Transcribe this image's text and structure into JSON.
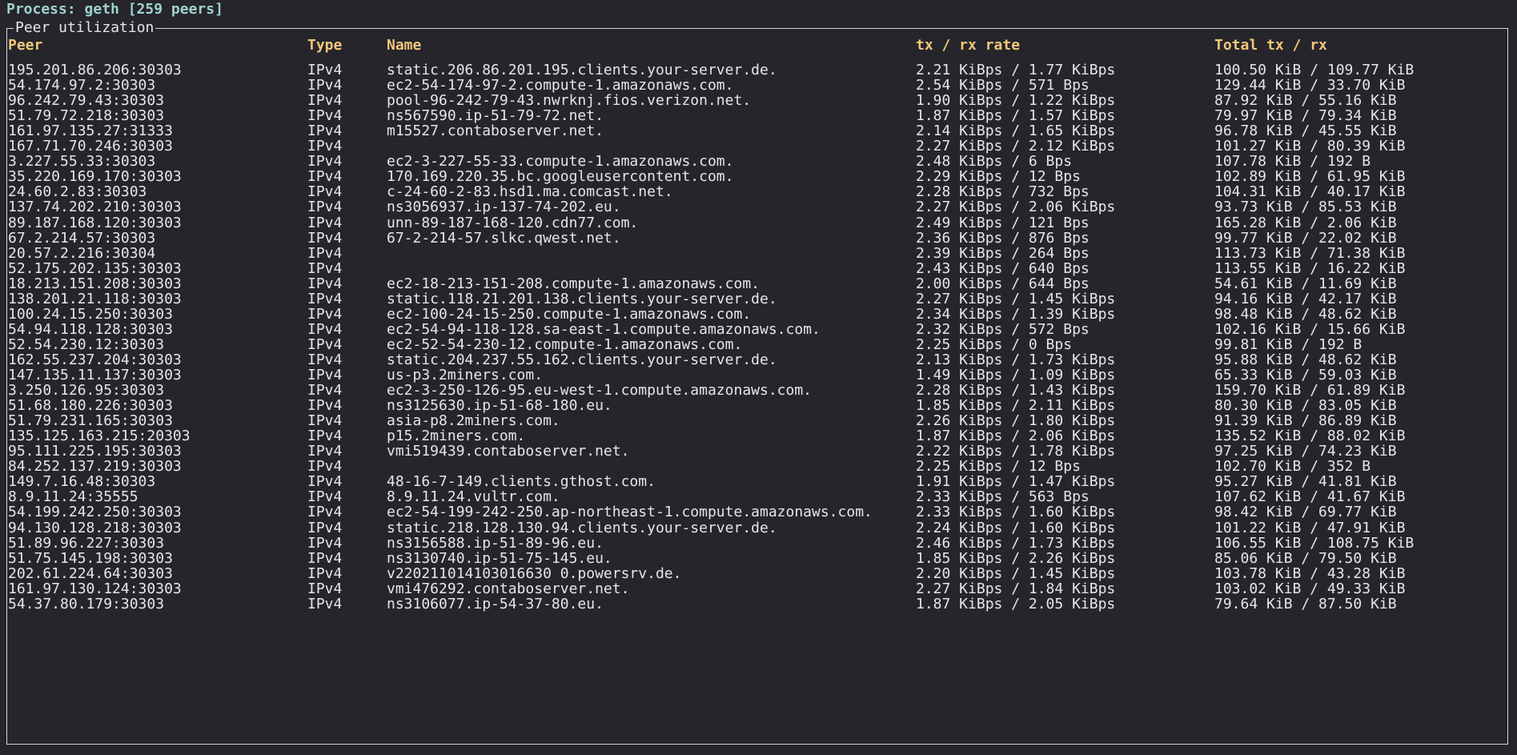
{
  "process": {
    "title": "Process: geth [259 peers]"
  },
  "panel": {
    "title": "Peer utilization"
  },
  "table": {
    "columns": [
      "Peer",
      "Type",
      "Name",
      "tx / rx rate",
      "Total tx / rx"
    ],
    "rows": [
      [
        "195.201.86.206:30303",
        "IPv4",
        "static.206.86.201.195.clients.your-server.de.",
        "2.21 KiBps / 1.77 KiBps",
        "100.50 KiB / 109.77 KiB"
      ],
      [
        "54.174.97.2:30303",
        "IPv4",
        "ec2-54-174-97-2.compute-1.amazonaws.com.",
        "2.54 KiBps / 571 Bps",
        "129.44 KiB / 33.70 KiB"
      ],
      [
        "96.242.79.43:30303",
        "IPv4",
        "pool-96-242-79-43.nwrknj.fios.verizon.net.",
        "1.90 KiBps / 1.22 KiBps",
        "87.92 KiB / 55.16 KiB"
      ],
      [
        "51.79.72.218:30303",
        "IPv4",
        "ns567590.ip-51-79-72.net.",
        "1.87 KiBps / 1.57 KiBps",
        "79.97 KiB / 79.34 KiB"
      ],
      [
        "161.97.135.27:31333",
        "IPv4",
        "m15527.contaboserver.net.",
        "2.14 KiBps / 1.65 KiBps",
        "96.78 KiB / 45.55 KiB"
      ],
      [
        "167.71.70.246:30303",
        "IPv4",
        "",
        "2.27 KiBps / 2.12 KiBps",
        "101.27 KiB / 80.39 KiB"
      ],
      [
        "3.227.55.33:30303",
        "IPv4",
        "ec2-3-227-55-33.compute-1.amazonaws.com.",
        "2.48 KiBps / 6 Bps",
        "107.78 KiB / 192 B"
      ],
      [
        "35.220.169.170:30303",
        "IPv4",
        "170.169.220.35.bc.googleusercontent.com.",
        "2.29 KiBps / 12 Bps",
        "102.89 KiB / 61.95 KiB"
      ],
      [
        "24.60.2.83:30303",
        "IPv4",
        "c-24-60-2-83.hsd1.ma.comcast.net.",
        "2.28 KiBps / 732 Bps",
        "104.31 KiB / 40.17 KiB"
      ],
      [
        "137.74.202.210:30303",
        "IPv4",
        "ns3056937.ip-137-74-202.eu.",
        "2.27 KiBps / 2.06 KiBps",
        "93.73 KiB / 85.53 KiB"
      ],
      [
        "89.187.168.120:30303",
        "IPv4",
        "unn-89-187-168-120.cdn77.com.",
        "2.49 KiBps / 121 Bps",
        "165.28 KiB / 2.06 KiB"
      ],
      [
        "67.2.214.57:30303",
        "IPv4",
        "67-2-214-57.slkc.qwest.net.",
        "2.36 KiBps / 876 Bps",
        "99.77 KiB / 22.02 KiB"
      ],
      [
        "20.57.2.216:30304",
        "IPv4",
        "",
        "2.39 KiBps / 264 Bps",
        "113.73 KiB / 71.38 KiB"
      ],
      [
        "52.175.202.135:30303",
        "IPv4",
        "",
        "2.43 KiBps / 640 Bps",
        "113.55 KiB / 16.22 KiB"
      ],
      [
        "18.213.151.208:30303",
        "IPv4",
        "ec2-18-213-151-208.compute-1.amazonaws.com.",
        "2.00 KiBps / 644 Bps",
        "54.61 KiB / 11.69 KiB"
      ],
      [
        "138.201.21.118:30303",
        "IPv4",
        "static.118.21.201.138.clients.your-server.de.",
        "2.27 KiBps / 1.45 KiBps",
        "94.16 KiB / 42.17 KiB"
      ],
      [
        "100.24.15.250:30303",
        "IPv4",
        "ec2-100-24-15-250.compute-1.amazonaws.com.",
        "2.34 KiBps / 1.39 KiBps",
        "98.48 KiB / 48.62 KiB"
      ],
      [
        "54.94.118.128:30303",
        "IPv4",
        "ec2-54-94-118-128.sa-east-1.compute.amazonaws.com.",
        "2.32 KiBps / 572 Bps",
        "102.16 KiB / 15.66 KiB"
      ],
      [
        "52.54.230.12:30303",
        "IPv4",
        "ec2-52-54-230-12.compute-1.amazonaws.com.",
        "2.25 KiBps / 0 Bps",
        "99.81 KiB / 192 B"
      ],
      [
        "162.55.237.204:30303",
        "IPv4",
        "static.204.237.55.162.clients.your-server.de.",
        "2.13 KiBps / 1.73 KiBps",
        "95.88 KiB / 48.62 KiB"
      ],
      [
        "147.135.11.137:30303",
        "IPv4",
        "us-p3.2miners.com.",
        "1.49 KiBps / 1.09 KiBps",
        "65.33 KiB / 59.03 KiB"
      ],
      [
        "3.250.126.95:30303",
        "IPv4",
        "ec2-3-250-126-95.eu-west-1.compute.amazonaws.com.",
        "2.28 KiBps / 1.43 KiBps",
        "159.70 KiB / 61.89 KiB"
      ],
      [
        "51.68.180.226:30303",
        "IPv4",
        "ns3125630.ip-51-68-180.eu.",
        "1.85 KiBps / 2.11 KiBps",
        "80.30 KiB / 83.05 KiB"
      ],
      [
        "51.79.231.165:30303",
        "IPv4",
        "asia-p8.2miners.com.",
        "2.26 KiBps / 1.80 KiBps",
        "91.39 KiB / 86.89 KiB"
      ],
      [
        "135.125.163.215:20303",
        "IPv4",
        "p15.2miners.com.",
        "1.87 KiBps / 2.06 KiBps",
        "135.52 KiB / 88.02 KiB"
      ],
      [
        "95.111.225.195:30303",
        "IPv4",
        "vmi519439.contaboserver.net.",
        "2.22 KiBps / 1.78 KiBps",
        "97.25 KiB / 74.23 KiB"
      ],
      [
        "84.252.137.219:30303",
        "IPv4",
        "",
        "2.25 KiBps / 12 Bps",
        "102.70 KiB / 352 B"
      ],
      [
        "149.7.16.48:30303",
        "IPv4",
        "48-16-7-149.clients.gthost.com.",
        "1.91 KiBps / 1.47 KiBps",
        "95.27 KiB / 41.81 KiB"
      ],
      [
        "8.9.11.24:35555",
        "IPv4",
        "8.9.11.24.vultr.com.",
        "2.33 KiBps / 563 Bps",
        "107.62 KiB / 41.67 KiB"
      ],
      [
        "54.199.242.250:30303",
        "IPv4",
        "ec2-54-199-242-250.ap-northeast-1.compute.amazonaws.com.",
        "2.33 KiBps / 1.60 KiBps",
        "98.42 KiB / 69.77 KiB"
      ],
      [
        "94.130.128.218:30303",
        "IPv4",
        "static.218.128.130.94.clients.your-server.de.",
        "2.24 KiBps / 1.60 KiBps",
        "101.22 KiB / 47.91 KiB"
      ],
      [
        "51.89.96.227:30303",
        "IPv4",
        "ns3156588.ip-51-89-96.eu.",
        "2.46 KiBps / 1.73 KiBps",
        "106.55 KiB / 108.75 KiB"
      ],
      [
        "51.75.145.198:30303",
        "IPv4",
        "ns3130740.ip-51-75-145.eu.",
        "1.85 KiBps / 2.26 KiBps",
        "85.06 KiB / 79.50 KiB"
      ],
      [
        "202.61.224.64:30303",
        "IPv4",
        "v220211014103016630 0.powersrv.de.",
        "2.20 KiBps / 1.45 KiBps",
        "103.78 KiB / 43.28 KiB"
      ],
      [
        "161.97.130.124:30303",
        "IPv4",
        "vmi476292.contaboserver.net.",
        "2.27 KiBps / 1.84 KiBps",
        "103.02 KiB / 49.33 KiB"
      ],
      [
        "54.37.80.179:30303",
        "IPv4",
        "ns3106077.ip-54-37-80.eu.",
        "1.87 KiBps / 2.05 KiBps",
        "79.64 KiB / 87.50 KiB"
      ]
    ]
  }
}
